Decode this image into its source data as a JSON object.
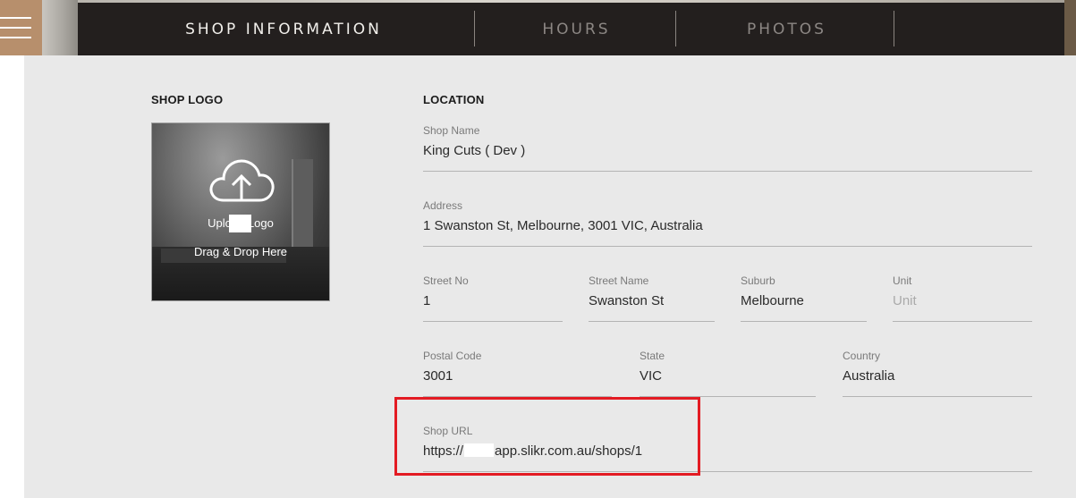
{
  "nav": {
    "menu_icon": "hamburger-icon",
    "tabs": [
      {
        "label": "SHOP INFORMATION",
        "active": true
      },
      {
        "label": "HOURS",
        "active": false
      },
      {
        "label": "PHOTOS",
        "active": false
      }
    ]
  },
  "logo_section": {
    "title": "SHOP LOGO",
    "upload_icon": "cloud-upload-icon",
    "upload_label": "Upload Logo",
    "drop_hint": "Drag & Drop Here"
  },
  "location": {
    "title": "LOCATION",
    "shop_name": {
      "label": "Shop Name",
      "value": "King Cuts ( Dev )"
    },
    "address": {
      "label": "Address",
      "value": "1 Swanston St, Melbourne, 3001 VIC, Australia"
    },
    "street_no": {
      "label": "Street No",
      "value": "1"
    },
    "street_name": {
      "label": "Street Name",
      "value": "Swanston St"
    },
    "suburb": {
      "label": "Suburb",
      "value": "Melbourne"
    },
    "unit": {
      "label": "Unit",
      "value": "",
      "placeholder": "Unit"
    },
    "postal_code": {
      "label": "Postal Code",
      "value": "3001"
    },
    "state": {
      "label": "State",
      "value": "VIC"
    },
    "country": {
      "label": "Country",
      "value": "Australia"
    },
    "shop_url": {
      "label": "Shop URL",
      "prefix": "https://",
      "value": "app.slikr.com.au/shops/1"
    }
  },
  "colors": {
    "nav_bg": "#231f1e",
    "menu_bg": "#b78f6c",
    "panel_bg": "#e9e9e9",
    "highlight": "#e31b23"
  }
}
